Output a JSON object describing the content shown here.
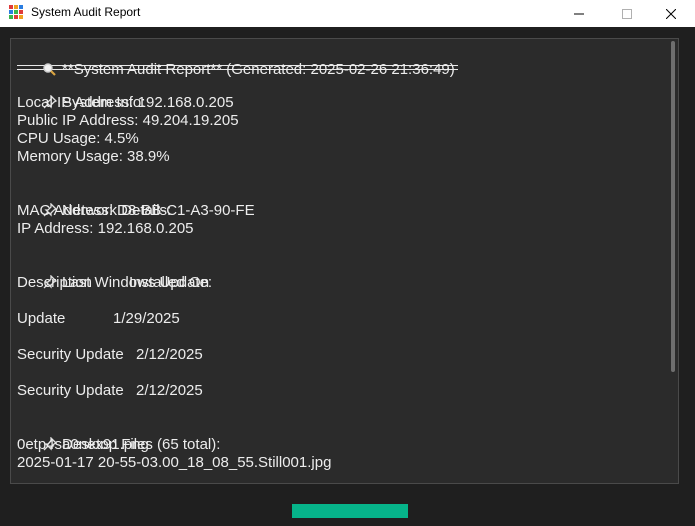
{
  "window": {
    "title": "System Audit Report",
    "icons": {
      "app": "app-grid-icon",
      "minimize": "minimize-icon",
      "maximize": "maximize-icon",
      "close": "close-icon"
    }
  },
  "report": {
    "header": "**System Audit Report** (Generated: 2025-02-26 21:36:49)",
    "header_icon": "magnifier-icon",
    "section_icon": "pushpin-icon",
    "system_info": {
      "heading": "System Info:",
      "lines": [
        "Local IP Address: 192.168.0.205",
        "Public IP Address: 49.204.19.205",
        "CPU Usage: 4.5%",
        "Memory Usage: 38.9%"
      ]
    },
    "network": {
      "heading": "Network Details:",
      "lines": [
        "MAC Address: D8-BB-C1-A3-90-FE",
        "IP Address: 192.168.0.205"
      ]
    },
    "updates": {
      "heading": "Last Windows Update:",
      "columns": [
        "Description",
        "Installed On"
      ],
      "rows": [
        {
          "description": "Update",
          "installed_on": "1/29/2025"
        },
        {
          "description": "Security Update",
          "installed_on": "2/12/2025"
        },
        {
          "description": "Security Update",
          "installed_on": "2/12/2025"
        }
      ]
    },
    "desktop": {
      "heading": "Desktop Files (65 total):",
      "files": [
        "0etp4sa0nex91.png",
        "2025-01-17 20-55-03.00_18_08_55.Still001.jpg"
      ]
    }
  },
  "progress": {
    "fraction": 1.0,
    "color": "#06b48a"
  }
}
